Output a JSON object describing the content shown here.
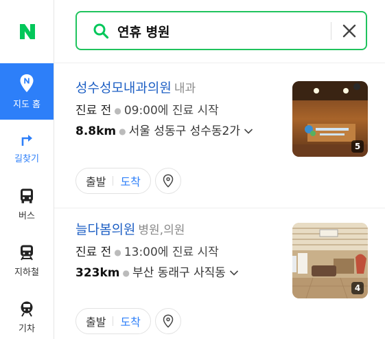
{
  "logo": "N",
  "colors": {
    "brand_green": "#03c75a",
    "accent_blue": "#2d7ff9",
    "link_blue": "#1d5fc4"
  },
  "nav": {
    "items": [
      {
        "label": "지도 홈",
        "icon": "map-pin-icon",
        "active": true
      },
      {
        "label": "길찾기",
        "icon": "directions-icon"
      },
      {
        "label": "버스",
        "icon": "bus-icon"
      },
      {
        "label": "지하철",
        "icon": "subway-icon"
      },
      {
        "label": "기차",
        "icon": "train-icon"
      }
    ]
  },
  "search": {
    "value": "연휴 병원",
    "search_icon": "search-icon",
    "clear_icon": "close-icon"
  },
  "results": [
    {
      "name": "성수성모내과의원",
      "category": "내과",
      "status": "진료 전",
      "time": "09:00에 진료 시작",
      "distance": "8.8km",
      "address": "서울 성동구 성수동2가",
      "photo_count": "5",
      "start_label": "출발",
      "arrive_label": "도착"
    },
    {
      "name": "늘다봄의원",
      "category": "병원,의원",
      "status": "진료 전",
      "time": "13:00에 진료 시작",
      "distance": "323km",
      "address": "부산 동래구 사직동",
      "photo_count": "4",
      "start_label": "출발",
      "arrive_label": "도착"
    }
  ]
}
